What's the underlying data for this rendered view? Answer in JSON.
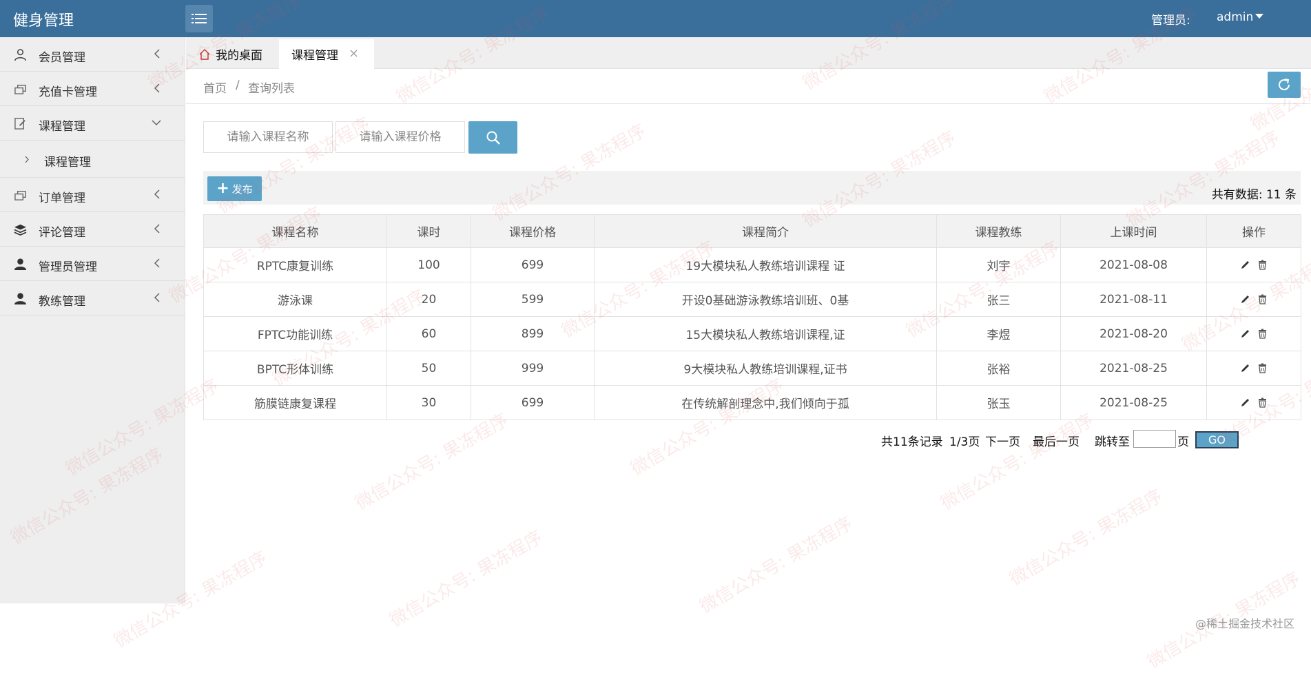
{
  "header": {
    "title": "健身管理",
    "admin_label": "管理员:",
    "admin_user": "admin"
  },
  "sidebar": {
    "items": [
      {
        "label": "会员管理",
        "icon": "user-icon"
      },
      {
        "label": "充值卡管理",
        "icon": "card-icon"
      },
      {
        "label": "课程管理",
        "icon": "edit-doc-icon",
        "expanded": true
      },
      {
        "label": "订单管理",
        "icon": "card-icon"
      },
      {
        "label": "评论管理",
        "icon": "stack-icon"
      },
      {
        "label": "管理员管理",
        "icon": "person-filled-icon"
      },
      {
        "label": "教练管理",
        "icon": "person-filled-icon"
      }
    ],
    "sub_items": [
      {
        "label": "课程管理"
      }
    ]
  },
  "tabs": {
    "home": "我的桌面",
    "active": "课程管理"
  },
  "breadcrumb": {
    "home": "首页",
    "separator": "/",
    "current": "查询列表"
  },
  "search": {
    "name_placeholder": "请输入课程名称",
    "price_placeholder": "请输入课程价格"
  },
  "toolbar": {
    "publish_label": "发布",
    "total_label": "共有数据: 11 条"
  },
  "table": {
    "headers": [
      "课程名称",
      "课时",
      "课程价格",
      "课程简介",
      "课程教练",
      "上课时间",
      "操作"
    ],
    "rows": [
      [
        "RPTC康复训练",
        "100",
        "699",
        "19大模块私人教练培训课程 证",
        "刘宇",
        "2021-08-08"
      ],
      [
        "游泳课",
        "20",
        "599",
        "开设0基础游泳教练培训班、0基",
        "张三",
        "2021-08-11"
      ],
      [
        "FPTC功能训练",
        "60",
        "899",
        "15大模块私人教练培训课程,证",
        "李煜",
        "2021-08-20"
      ],
      [
        "BPTC形体训练",
        "50",
        "999",
        "9大模块私人教练培训课程,证书",
        "张裕",
        "2021-08-25"
      ],
      [
        "筋膜链康复课程",
        "30",
        "699",
        "在传统解剖理念中,我们倾向于孤",
        "张玉",
        "2021-08-25"
      ]
    ]
  },
  "pagination": {
    "records": "共11条记录",
    "page_info": "1/3页",
    "next": "下一页",
    "last": "最后一页",
    "jump_to": "跳转至",
    "page_unit": "页",
    "go": "GO"
  },
  "watermark": "微信公众号: 果冻程序",
  "footer_credit": "@稀土掘金技术社区",
  "colors": {
    "topbar": "#3a6f9c",
    "accent": "#5ba3c9",
    "sidebar": "#eeeeee"
  }
}
